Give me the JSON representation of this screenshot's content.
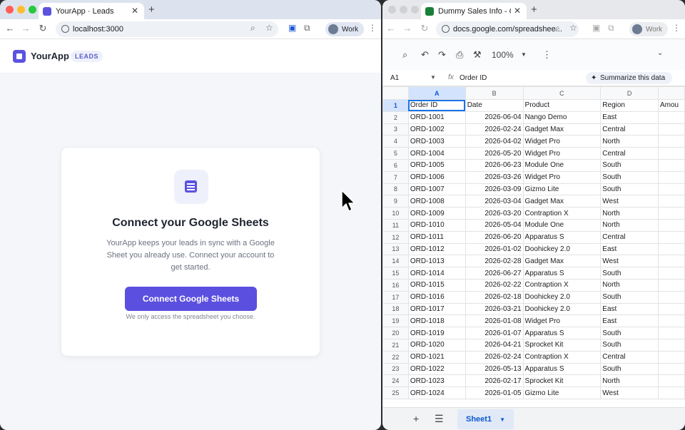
{
  "left_window": {
    "tab_title": "YourApp · Leads",
    "url": "localhost:3000",
    "profile": "Work",
    "app": {
      "name": "YourApp",
      "badge": "LEADS",
      "card_title": "Connect your Google Sheets",
      "card_desc": "YourApp keeps your leads in sync with a Google Sheet you already use. Connect your account to get started.",
      "connect_button": "Connect Google Sheets",
      "note": "We only access the spreadsheet you choose."
    }
  },
  "right_window": {
    "tab_title": "Dummy Sales Info - Google Sheets",
    "url": "docs.google.com/spreadshee...",
    "profile": "Work",
    "zoom": "100%",
    "cell_ref": "A1",
    "formula": "Order ID",
    "summarize": "Summarize this data",
    "columns": [
      "A",
      "B",
      "C",
      "D"
    ],
    "header": [
      "Order ID",
      "Date",
      "Product",
      "Region",
      "Amou"
    ],
    "rows": [
      [
        "ORD-1001",
        "2026-06-04",
        "Nango Demo",
        "East"
      ],
      [
        "ORD-1002",
        "2026-02-24",
        "Gadget Max",
        "Central"
      ],
      [
        "ORD-1003",
        "2026-04-02",
        "Widget Pro",
        "North"
      ],
      [
        "ORD-1004",
        "2026-05-20",
        "Widget Pro",
        "Central"
      ],
      [
        "ORD-1005",
        "2026-06-23",
        "Module One",
        "South"
      ],
      [
        "ORD-1006",
        "2026-03-26",
        "Widget Pro",
        "South"
      ],
      [
        "ORD-1007",
        "2026-03-09",
        "Gizmo Lite",
        "South"
      ],
      [
        "ORD-1008",
        "2026-03-04",
        "Gadget Max",
        "West"
      ],
      [
        "ORD-1009",
        "2026-03-20",
        "Contraption X",
        "North"
      ],
      [
        "ORD-1010",
        "2026-05-04",
        "Module One",
        "North"
      ],
      [
        "ORD-1011",
        "2026-06-20",
        "Apparatus S",
        "Central"
      ],
      [
        "ORD-1012",
        "2026-01-02",
        "Doohickey 2.0",
        "East"
      ],
      [
        "ORD-1013",
        "2026-02-28",
        "Gadget Max",
        "West"
      ],
      [
        "ORD-1014",
        "2026-06-27",
        "Apparatus S",
        "South"
      ],
      [
        "ORD-1015",
        "2026-02-22",
        "Contraption X",
        "North"
      ],
      [
        "ORD-1016",
        "2026-02-18",
        "Doohickey 2.0",
        "South"
      ],
      [
        "ORD-1017",
        "2026-03-21",
        "Doohickey 2.0",
        "East"
      ],
      [
        "ORD-1018",
        "2026-01-08",
        "Widget Pro",
        "East"
      ],
      [
        "ORD-1019",
        "2026-01-07",
        "Apparatus S",
        "South"
      ],
      [
        "ORD-1020",
        "2026-04-21",
        "Sprocket Kit",
        "South"
      ],
      [
        "ORD-1021",
        "2026-02-24",
        "Contraption X",
        "Central"
      ],
      [
        "ORD-1022",
        "2026-05-13",
        "Apparatus S",
        "South"
      ],
      [
        "ORD-1023",
        "2026-02-17",
        "Sprocket Kit",
        "North"
      ],
      [
        "ORD-1024",
        "2026-01-05",
        "Gizmo Lite",
        "West"
      ]
    ],
    "sheet_tab": "Sheet1"
  }
}
